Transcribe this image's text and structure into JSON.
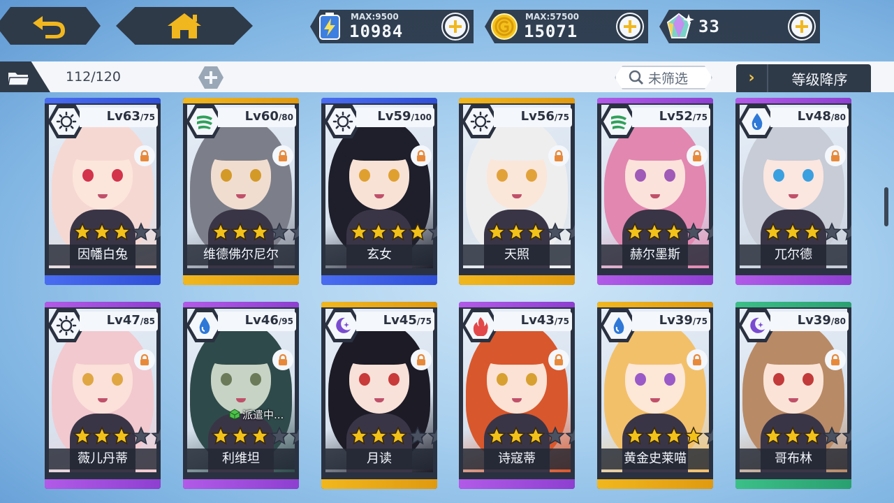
{
  "nav": {
    "back_icon": "back-arrow-icon",
    "home_icon": "home-icon"
  },
  "resources": {
    "energy": {
      "max_label": "MAX:",
      "max_value": "9500",
      "value": "10984",
      "icon": "energy-battery-icon"
    },
    "gold": {
      "max_label": "MAX:",
      "max_value": "57500",
      "value": "15071",
      "icon": "gold-coin-icon"
    },
    "gems": {
      "value": "33",
      "icon": "crystal-gem-icon"
    }
  },
  "filterbar": {
    "count": "112/120",
    "filter_label": "未筛选",
    "sort_label": "等级降序",
    "sort_chevron": "›"
  },
  "colors": {
    "blue": "#4a6cf0",
    "gold": "#f1b71e",
    "purple": "#b25ae8",
    "green": "#3cbf88",
    "dark": "#2a3140",
    "star": "#f3c21a"
  },
  "characters": [
    {
      "level": "Lv63",
      "max": "/75",
      "element": "sun",
      "stars": 3,
      "name": "因幡白兔",
      "rarity": "blue",
      "hair": "#f6d8d2",
      "skin": "#fce6dc",
      "eye": "#d3334b"
    },
    {
      "level": "Lv60",
      "max": "/80",
      "element": "wind",
      "stars": 3,
      "name": "维德佛尔尼尔",
      "rarity": "gold",
      "hair": "#7c7f89",
      "skin": "#f1ddd0",
      "eye": "#d49a28"
    },
    {
      "level": "Lv59",
      "max": "/100",
      "element": "sun",
      "stars": 4,
      "name": "玄女",
      "rarity": "blue",
      "hair": "#1e1f2b",
      "skin": "#f8e2d6",
      "eye": "#e0a030"
    },
    {
      "level": "Lv56",
      "max": "/75",
      "element": "sun",
      "stars": 3,
      "name": "天照",
      "rarity": "gold",
      "hair": "#eeeeee",
      "skin": "#fbe6da",
      "eye": "#e2a23a"
    },
    {
      "level": "Lv52",
      "max": "/75",
      "element": "wind",
      "stars": 3,
      "name": "赫尔墨斯",
      "rarity": "purple",
      "hair": "#e287b0",
      "skin": "#fbe2db",
      "eye": "#a05ab8"
    },
    {
      "level": "Lv48",
      "max": "/80",
      "element": "water",
      "stars": 3,
      "name": "兀尔德",
      "rarity": "purple",
      "hair": "#c7ccd6",
      "skin": "#fbe6e0",
      "eye": "#3aa0e0"
    },
    {
      "level": "Lv47",
      "max": "/85",
      "element": "sun",
      "stars": 3,
      "name": "薇儿丹蒂",
      "rarity": "purple",
      "hair": "#f2c9cf",
      "skin": "#fbe1d9",
      "eye": "#e0a642"
    },
    {
      "level": "Lv46",
      "max": "/95",
      "element": "water",
      "stars": 3,
      "name": "利维坦",
      "rarity": "purple",
      "hair": "#2f4a4a",
      "skin": "#c7d3c4",
      "eye": "#6b7a58",
      "dispatch": "派遣中..."
    },
    {
      "level": "Lv45",
      "max": "/75",
      "element": "moon",
      "stars": 3,
      "name": "月读",
      "rarity": "gold",
      "hair": "#1c1b26",
      "skin": "#f8e1d8",
      "eye": "#c93a3a"
    },
    {
      "level": "Lv43",
      "max": "/75",
      "element": "fire",
      "stars": 3,
      "name": "诗寇蒂",
      "rarity": "purple",
      "hair": "#d9572c",
      "skin": "#fbe2d4",
      "eye": "#d8a030"
    },
    {
      "level": "Lv39",
      "max": "/75",
      "element": "water",
      "stars": 4,
      "name": "黄金史莱喵",
      "rarity": "gold",
      "hair": "#f3c06a",
      "skin": "#fde7d6",
      "eye": "#9a5ac8"
    },
    {
      "level": "Lv39",
      "max": "/80",
      "element": "moon",
      "stars": 3,
      "name": "哥布林",
      "rarity": "green",
      "hair": "#b98a66",
      "skin": "#fbe4d7",
      "eye": "#c33a3a"
    }
  ]
}
